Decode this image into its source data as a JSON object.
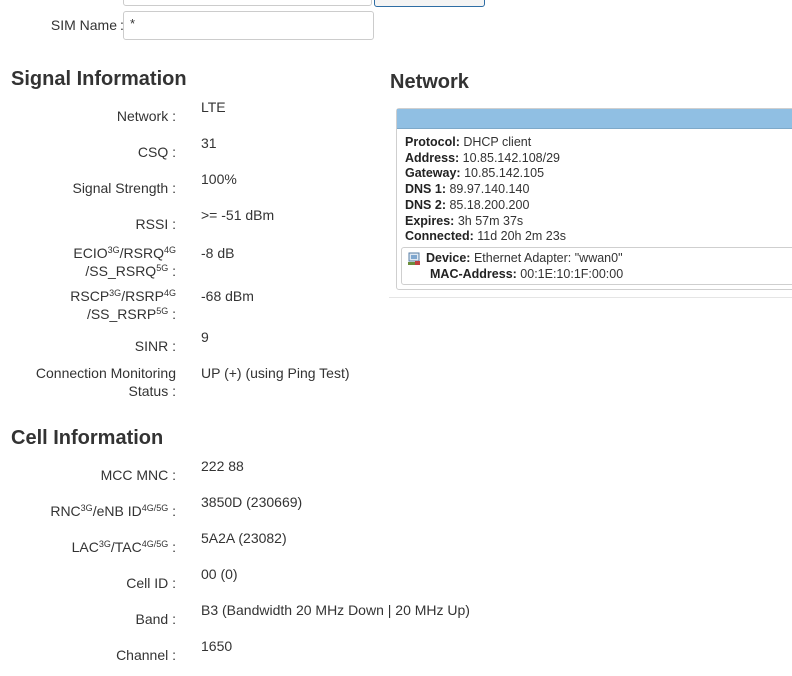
{
  "sim": {
    "label": "SIM Name",
    "colon": ":",
    "value": "*"
  },
  "signal": {
    "title": "Signal Information",
    "rows": [
      {
        "label": "Network :",
        "value": "LTE"
      },
      {
        "label": "CSQ :",
        "value": "31"
      },
      {
        "label": "Signal Strength :",
        "value": "100%"
      },
      {
        "label": "RSSI :",
        "value": ">= -51 dBm"
      },
      {
        "label_line1_a": "ECIO",
        "label_line1_sup1": "3G",
        "label_line1_b": "/RSRQ",
        "label_line1_sup2": "4G",
        "label_line2_a": "/SS_RSRQ",
        "label_line2_sup": "5G",
        "label_line2_colon": " :",
        "value": "-8 dB"
      },
      {
        "label_line1_a": "RSCP",
        "label_line1_sup1": "3G",
        "label_line1_b": "/RSRP",
        "label_line1_sup2": "4G",
        "label_line2_a": "/SS_RSRP",
        "label_line2_sup": "5G",
        "label_line2_colon": " :",
        "value": "-68 dBm"
      },
      {
        "label": "SINR :",
        "value": "9"
      },
      {
        "label_line1": "Connection Monitoring",
        "label_line2": "Status :",
        "value": "UP (+) (using Ping Test)"
      }
    ]
  },
  "cell": {
    "title": "Cell Information",
    "rows": [
      {
        "label": "MCC MNC :",
        "value": "222 88"
      },
      {
        "label_a": "RNC",
        "label_sup1": "3G",
        "label_b": "/eNB ID",
        "label_sup2": "4G/5G",
        "label_colon": " :",
        "value": "3850D (230669)"
      },
      {
        "label_a": "LAC",
        "label_sup1": "3G",
        "label_b": "/TAC",
        "label_sup2": "4G/5G",
        "label_colon": " :",
        "value": "5A2A (23082)"
      },
      {
        "label": "Cell ID :",
        "value": "00 (0)"
      },
      {
        "label": "Band :",
        "value": "B3 (Bandwidth 20 MHz Down | 20 MHz Up)"
      },
      {
        "label": "Channel :",
        "value": "1650"
      }
    ]
  },
  "network": {
    "title": "Network",
    "header_color": "#90bfe3",
    "fields": {
      "protocol_label": "Protocol:",
      "protocol_value": "DHCP client",
      "address_label": "Address:",
      "address_value": "10.85.142.108/29",
      "gateway_label": "Gateway:",
      "gateway_value": "10.85.142.105",
      "dns1_label": "DNS 1:",
      "dns1_value": "89.97.140.140",
      "dns2_label": "DNS 2:",
      "dns2_value": "85.18.200.200",
      "expires_label": "Expires:",
      "expires_value": "3h 57m 37s",
      "connected_label": "Connected:",
      "connected_value": "11d 20h 2m 23s"
    },
    "device": {
      "icon": "ethernet-adapter-icon",
      "device_label": "Device:",
      "device_value": "Ethernet Adapter: \"wwan0\"",
      "mac_label": "MAC-Address:",
      "mac_value": "00:1E:10:1F:00:00"
    }
  }
}
